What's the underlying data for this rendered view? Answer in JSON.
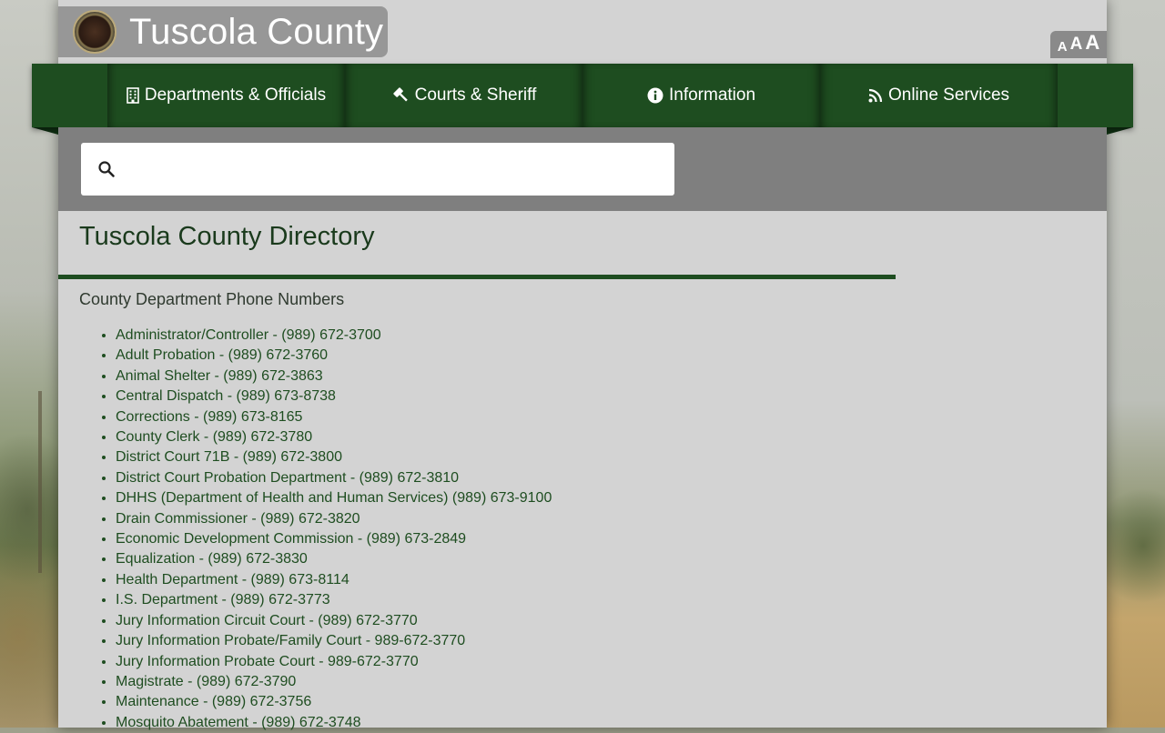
{
  "site": {
    "title": "Tuscola County"
  },
  "text_size": {
    "small": "A",
    "medium": "A",
    "large": "A"
  },
  "nav": [
    {
      "label": "Departments & Officials",
      "icon": "building-icon"
    },
    {
      "label": "Courts & Sheriff",
      "icon": "gavel-icon"
    },
    {
      "label": "Information",
      "icon": "info-icon"
    },
    {
      "label": "Online Services",
      "icon": "rss-icon"
    }
  ],
  "search": {
    "placeholder": "",
    "value": ""
  },
  "main": {
    "title": "Tuscola County Directory",
    "subheading": "County Department Phone Numbers",
    "items": [
      "Administrator/Controller - (989) 672-3700",
      "Adult Probation - (989) 672-3760",
      "Animal Shelter - (989) 672-3863",
      "Central Dispatch - (989) 673-8738",
      "Corrections - (989) 673-8165",
      "County Clerk - (989) 672-3780",
      "District Court 71B - (989) 672-3800",
      "District Court Probation Department - (989) 672-3810",
      "DHHS (Department of Health and Human Services) (989) 673-9100",
      "Drain Commissioner - (989) 672-3820",
      "Economic Development Commission - (989) 673-2849",
      "Equalization - (989) 672-3830",
      "Health Department - (989) 673-8114",
      "I.S. Department - (989) 672-3773",
      "Jury Information Circuit Court - (989) 672-3770",
      "Jury Information Probate/Family Court - 989-672-3770",
      "Jury Information Probate Court - 989-672-3770",
      "Magistrate - (989) 672-3790",
      "Maintenance - (989) 672-3756",
      "Mosquito Abatement - (989) 672-3748"
    ]
  },
  "colors": {
    "brand_green": "#1e4d20",
    "page_bg": "#d3d3d3",
    "search_band": "#7f7f7f"
  }
}
